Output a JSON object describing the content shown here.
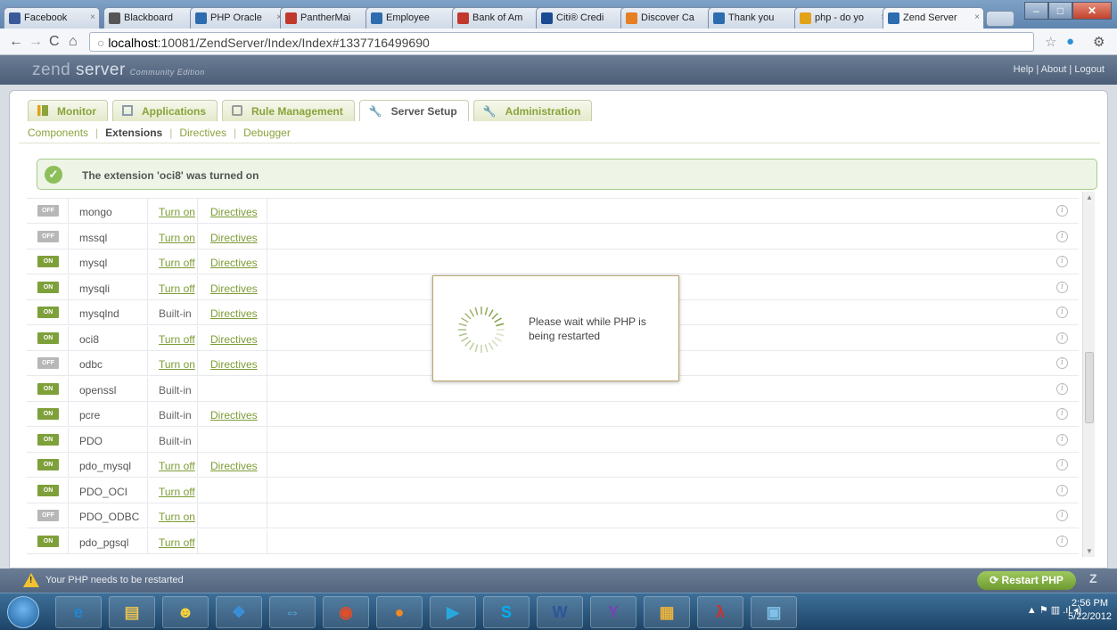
{
  "browser": {
    "tabs": [
      {
        "label": "Facebook",
        "color": "#3b5998"
      },
      {
        "label": "Blackboard",
        "color": "#555555"
      },
      {
        "label": "PHP Oracle",
        "color": "#2d6cae"
      },
      {
        "label": "PantherMai",
        "color": "#c0392b"
      },
      {
        "label": "Employee",
        "color": "#2d6cae"
      },
      {
        "label": "Bank of Am",
        "color": "#c0392b"
      },
      {
        "label": "Citi® Credi",
        "color": "#1a4a8f"
      },
      {
        "label": "Discover Ca",
        "color": "#e67e22"
      },
      {
        "label": "Thank you",
        "color": "#2d6cae"
      },
      {
        "label": "php - do yo",
        "color": "#e2a21a"
      },
      {
        "label": "Zend Server",
        "color": "#2d6cae"
      }
    ],
    "url_host": "localhost",
    "url_path": ":10081/ZendServer/Index/Index#1337716499690"
  },
  "app": {
    "brand_zend": "zend",
    "brand_server": "server",
    "edition": "Community Edition",
    "links": "Help | About | Logout",
    "tabs": [
      "Monitor",
      "Applications",
      "Rule Management",
      "Server Setup",
      "Administration"
    ],
    "subnav": [
      "Components",
      "Extensions",
      "Directives",
      "Debugger"
    ],
    "notice": "The extension 'oci8' was turned on",
    "modal_text": "Please wait while PHP is being restarted",
    "status_text": "Your PHP needs to be restarted",
    "restart_label": "Restart PHP",
    "zend_mark": "Z"
  },
  "extensions": [
    {
      "state": "OFF",
      "name": "mongo",
      "action": "Turn on",
      "directives": "Directives"
    },
    {
      "state": "OFF",
      "name": "mssql",
      "action": "Turn on",
      "directives": "Directives"
    },
    {
      "state": "ON",
      "name": "mysql",
      "action": "Turn off",
      "directives": "Directives"
    },
    {
      "state": "ON",
      "name": "mysqli",
      "action": "Turn off",
      "directives": "Directives"
    },
    {
      "state": "ON",
      "name": "mysqlnd",
      "action": "Built-in",
      "directives": "Directives"
    },
    {
      "state": "ON",
      "name": "oci8",
      "action": "Turn off",
      "directives": "Directives"
    },
    {
      "state": "OFF",
      "name": "odbc",
      "action": "Turn on",
      "directives": "Directives"
    },
    {
      "state": "ON",
      "name": "openssl",
      "action": "Built-in",
      "directives": ""
    },
    {
      "state": "ON",
      "name": "pcre",
      "action": "Built-in",
      "directives": "Directives"
    },
    {
      "state": "ON",
      "name": "PDO",
      "action": "Built-in",
      "directives": ""
    },
    {
      "state": "ON",
      "name": "pdo_mysql",
      "action": "Turn off",
      "directives": "Directives"
    },
    {
      "state": "ON",
      "name": "PDO_OCI",
      "action": "Turn off",
      "directives": ""
    },
    {
      "state": "OFF",
      "name": "PDO_ODBC",
      "action": "Turn on",
      "directives": ""
    },
    {
      "state": "ON",
      "name": "pdo_pgsql",
      "action": "Turn off",
      "directives": ""
    }
  ],
  "taskbar": {
    "clock_time": "2:56 PM",
    "clock_date": "5/22/2012"
  }
}
